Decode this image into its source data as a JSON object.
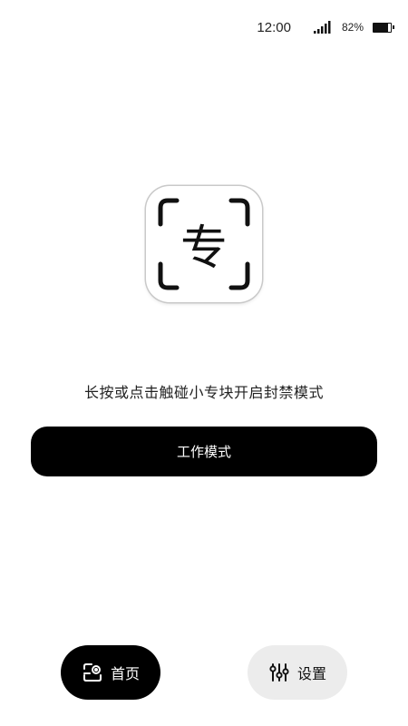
{
  "status_bar": {
    "time": "12:00",
    "battery_text": "82%",
    "battery_level": 0.82
  },
  "logo": {
    "character": "专",
    "icon": "app-logo-icon"
  },
  "main": {
    "hint": "长按或点击触碰小专块开启封禁模式",
    "work_mode_button": "工作模式"
  },
  "bottom_nav": {
    "home": {
      "label": "首页",
      "icon": "home-icon",
      "active": true
    },
    "settings": {
      "label": "设置",
      "icon": "sliders-icon",
      "active": false
    }
  },
  "colors": {
    "primary": "#000000",
    "background": "#ffffff",
    "inactive_tab": "#ececec"
  }
}
